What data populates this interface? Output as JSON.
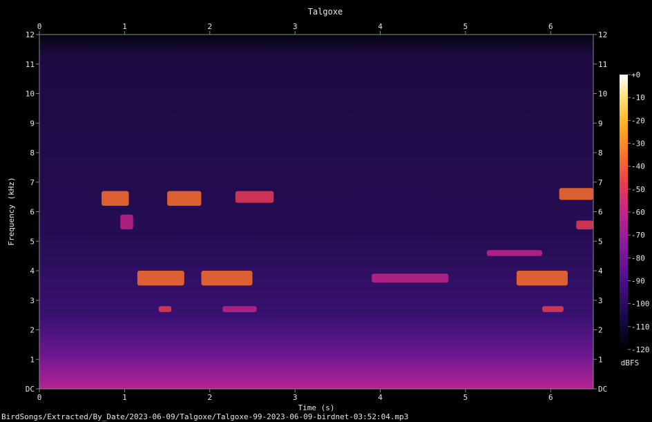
{
  "chart_data": {
    "type": "heatmap",
    "title": "Talgoxe",
    "xlabel": "Time (s)",
    "ylabel": "Frequency (kHz)",
    "xlim": [
      0,
      6.5
    ],
    "ylim": [
      0,
      12
    ],
    "x_ticks": [
      "0",
      "1",
      "2",
      "3",
      "4",
      "5",
      "6"
    ],
    "y_ticks": [
      "DC",
      "1",
      "2",
      "3",
      "4",
      "5",
      "6",
      "7",
      "8",
      "9",
      "10",
      "11",
      "12"
    ],
    "colorbar": {
      "label": "dBFS",
      "range": [
        -120,
        0
      ],
      "ticks": [
        "+0",
        "-10",
        "-20",
        "-30",
        "-40",
        "-50",
        "-60",
        "-70",
        "-80",
        "-90",
        "-100",
        "-110",
        "-120"
      ],
      "colors": [
        "#000000",
        "#1a0a4d",
        "#4a0f8a",
        "#8a1a9c",
        "#c2248a",
        "#ea3a55",
        "#fb6f2a",
        "#fdb21f",
        "#fde37a",
        "#ffffff"
      ]
    },
    "syllables": [
      {
        "t0": 0.73,
        "t1": 1.05,
        "f0": 6.2,
        "f1": 6.7,
        "level": -42
      },
      {
        "t0": 1.15,
        "t1": 1.7,
        "f0": 3.5,
        "f1": 4.0,
        "level": -38
      },
      {
        "t0": 1.5,
        "t1": 1.9,
        "f0": 6.2,
        "f1": 6.7,
        "level": -45
      },
      {
        "t0": 1.9,
        "t1": 2.5,
        "f0": 3.5,
        "f1": 4.0,
        "level": -40
      },
      {
        "t0": 2.3,
        "t1": 2.75,
        "f0": 6.3,
        "f1": 6.7,
        "level": -47
      },
      {
        "t0": 0.95,
        "t1": 1.1,
        "f0": 5.4,
        "f1": 5.9,
        "level": -62
      },
      {
        "t0": 1.4,
        "t1": 1.55,
        "f0": 2.6,
        "f1": 2.8,
        "level": -60
      },
      {
        "t0": 2.15,
        "t1": 2.55,
        "f0": 2.6,
        "f1": 2.8,
        "level": -62
      },
      {
        "t0": 3.9,
        "t1": 4.8,
        "f0": 3.6,
        "f1": 3.9,
        "level": -72
      },
      {
        "t0": 5.25,
        "t1": 5.9,
        "f0": 4.5,
        "f1": 4.7,
        "level": -66
      },
      {
        "t0": 5.6,
        "t1": 6.2,
        "f0": 3.5,
        "f1": 4.0,
        "level": -42
      },
      {
        "t0": 6.1,
        "t1": 6.5,
        "f0": 6.4,
        "f1": 6.8,
        "level": -46
      },
      {
        "t0": 6.3,
        "t1": 6.5,
        "f0": 5.4,
        "f1": 5.7,
        "level": -58
      },
      {
        "t0": 5.9,
        "t1": 6.15,
        "f0": 2.6,
        "f1": 2.8,
        "level": -60
      }
    ]
  },
  "footer": {
    "path": "BirdSongs/Extracted/By_Date/2023-06-09/Talgoxe/Talgoxe-99-2023-06-09-birdnet-03:52:04.mp3"
  }
}
